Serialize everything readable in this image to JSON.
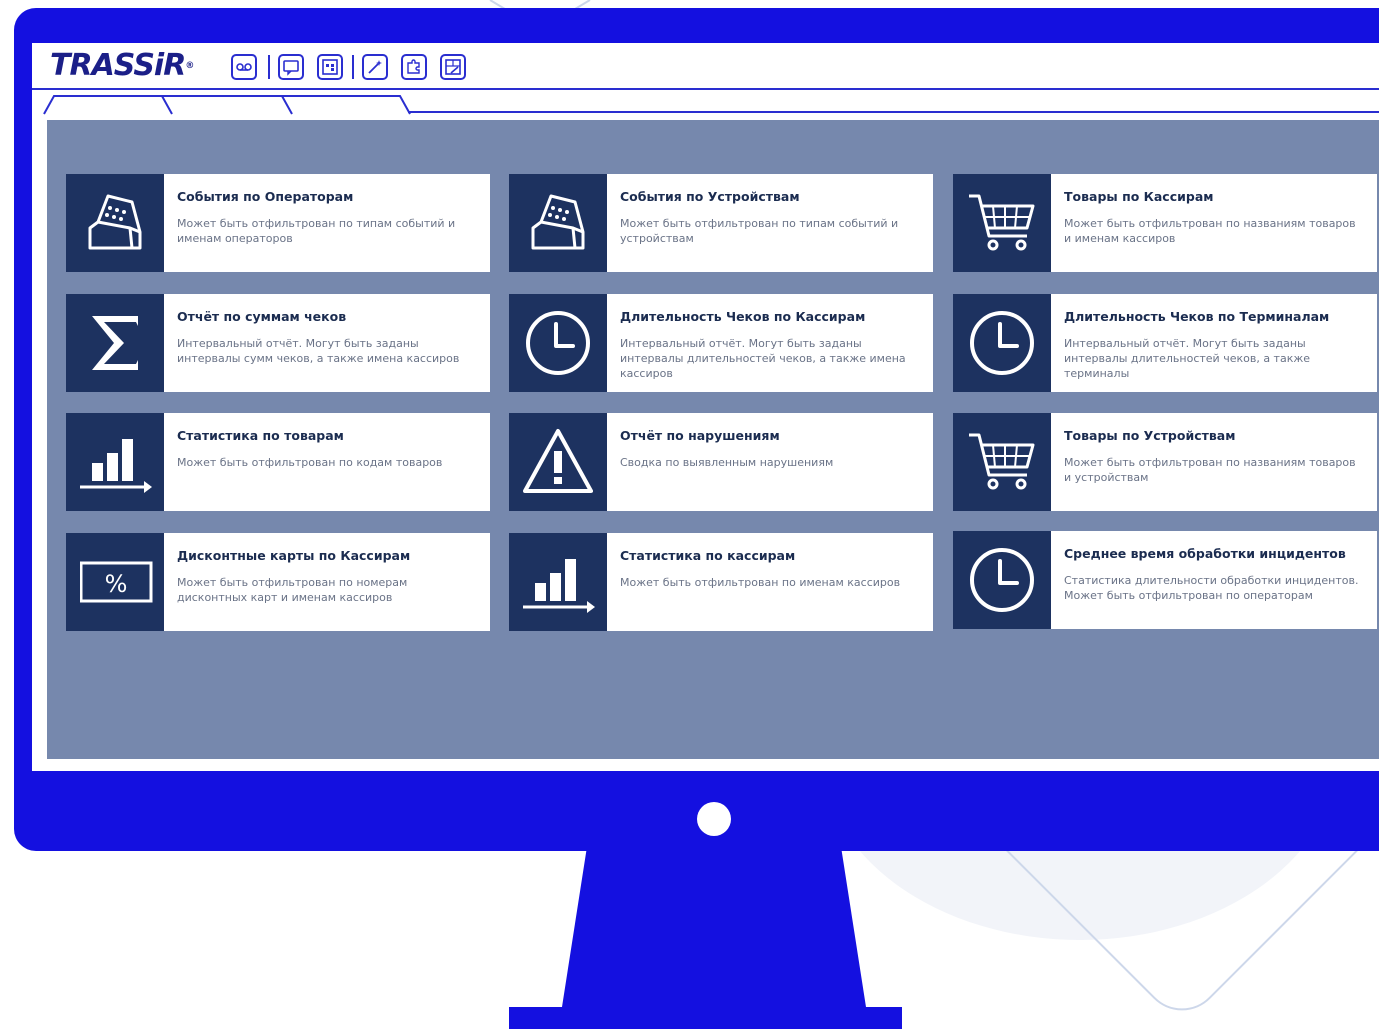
{
  "app": {
    "logo_text": "TRASSiR"
  },
  "toolbar": {
    "icons": [
      "tape-icon",
      "message-icon",
      "layout-icon",
      "wand-icon",
      "puzzle-icon",
      "editor-icon"
    ]
  },
  "tabs": [
    "",
    "",
    ""
  ],
  "reports": [
    {
      "title": "События по Операторам",
      "desc": "Может быть отфильтрован по типам событий и именам операторов",
      "icon": "cash-register-icon"
    },
    {
      "title": "События по Устройствам",
      "desc": "Может быть отфильтрован по типам событий и устройствам",
      "icon": "cash-register-icon"
    },
    {
      "title": "Товары по Кассирам",
      "desc": "Может быть отфильтрован по названиям товаров и именам кассиров",
      "icon": "cart-icon"
    },
    {
      "title": "Отчёт по суммам чеков",
      "desc": "Интервальный отчёт. Могут быть заданы интервалы сумм чеков, а также имена кассиров",
      "icon": "sigma-icon"
    },
    {
      "title": "Длительность Чеков по Кассирам",
      "desc": "Интервальный отчёт. Могут быть заданы интервалы длительностей чеков, а также имена кассиров",
      "icon": "clock-icon"
    },
    {
      "title": "Длительность Чеков по Терминалам",
      "desc": "Интервальный отчёт. Могут быть заданы интервалы длительностей чеков, а также терминалы",
      "icon": "clock-icon"
    },
    {
      "title": "Статистика по товарам",
      "desc": "Может быть отфильтрован по кодам товаров",
      "icon": "bar-chart-icon"
    },
    {
      "title": "Отчёт по нарушениям",
      "desc": "Сводка по выявленным нарушениям",
      "icon": "warning-icon"
    },
    {
      "title": "Товары по Устройствам",
      "desc": "Может быть отфильтрован по названиям товаров и устройствам",
      "icon": "cart-icon"
    },
    {
      "title": "Дисконтные карты по Кассирам",
      "desc": "Может быть отфильтрован по номерам дисконтных карт и именам кассиров",
      "icon": "percent-card-icon"
    },
    {
      "title": "Статистика по кассирам",
      "desc": "Может быть отфильтрован по именам кассиров",
      "icon": "bar-chart-icon"
    },
    {
      "title": "Среднее время обработки инцидентов",
      "desc": "Статистика длительности обработки инцидентов. Может быть отфильтрован по операторам",
      "icon": "clock-icon"
    }
  ],
  "colors": {
    "monitor": "#1410e0",
    "panel": "#7688ad",
    "icon_bg": "#1d3260",
    "title": "#1b2c50",
    "desc": "#6a7387"
  }
}
